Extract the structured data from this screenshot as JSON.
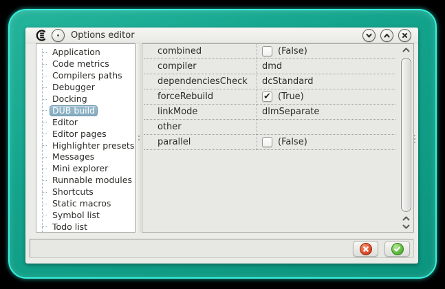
{
  "titlebar": {
    "title": "Options editor",
    "app_icon": "coedit-logo-icon",
    "menu_button_icon": "window-menu-dot-icon",
    "buttons": [
      {
        "name": "minimize",
        "icon": "chevron-down-icon"
      },
      {
        "name": "maximize",
        "icon": "chevron-up-icon"
      },
      {
        "name": "close",
        "icon": "close-x-icon"
      }
    ]
  },
  "sidebar": {
    "items": [
      {
        "label": "Application"
      },
      {
        "label": "Code metrics"
      },
      {
        "label": "Compilers paths"
      },
      {
        "label": "Debugger"
      },
      {
        "label": "Docking"
      },
      {
        "label": "DUB build",
        "selected": true
      },
      {
        "label": "Editor"
      },
      {
        "label": "Editor pages"
      },
      {
        "label": "Highlighter presets"
      },
      {
        "label": "Messages"
      },
      {
        "label": "Mini explorer"
      },
      {
        "label": "Runnable modules"
      },
      {
        "label": "Shortcuts"
      },
      {
        "label": "Static macros"
      },
      {
        "label": "Symbol list"
      },
      {
        "label": "Todo list"
      }
    ],
    "selected_item": "DUB build"
  },
  "properties": {
    "rows": [
      {
        "name": "combined",
        "value": "(False)",
        "checkbox": "unchecked"
      },
      {
        "name": "compiler",
        "value": "dmd"
      },
      {
        "name": "dependenciesCheck",
        "value": "dcStandard"
      },
      {
        "name": "forceRebuild",
        "value": "(True)",
        "checkbox": "checked"
      },
      {
        "name": "linkMode",
        "value": "dlmSeparate"
      },
      {
        "name": "other",
        "value": ""
      },
      {
        "name": "parallel",
        "value": "(False)",
        "checkbox": "unchecked"
      }
    ]
  },
  "scrollbar": {
    "icons": [
      "chevron-up-icon",
      "chevron-up-icon",
      "chevron-down-icon"
    ]
  },
  "footer": {
    "buttons": [
      {
        "name": "cancel",
        "icon": "red-cross-icon"
      },
      {
        "name": "accept",
        "icon": "green-check-icon"
      }
    ]
  },
  "colors": {
    "frame_teal": "#13a38c",
    "frame_glow": "#35f1dd",
    "window_bg": "#ebebe7",
    "selection_blue": "#84abc0",
    "cancel_red": "#e2512e",
    "accept_green": "#63bd43"
  }
}
